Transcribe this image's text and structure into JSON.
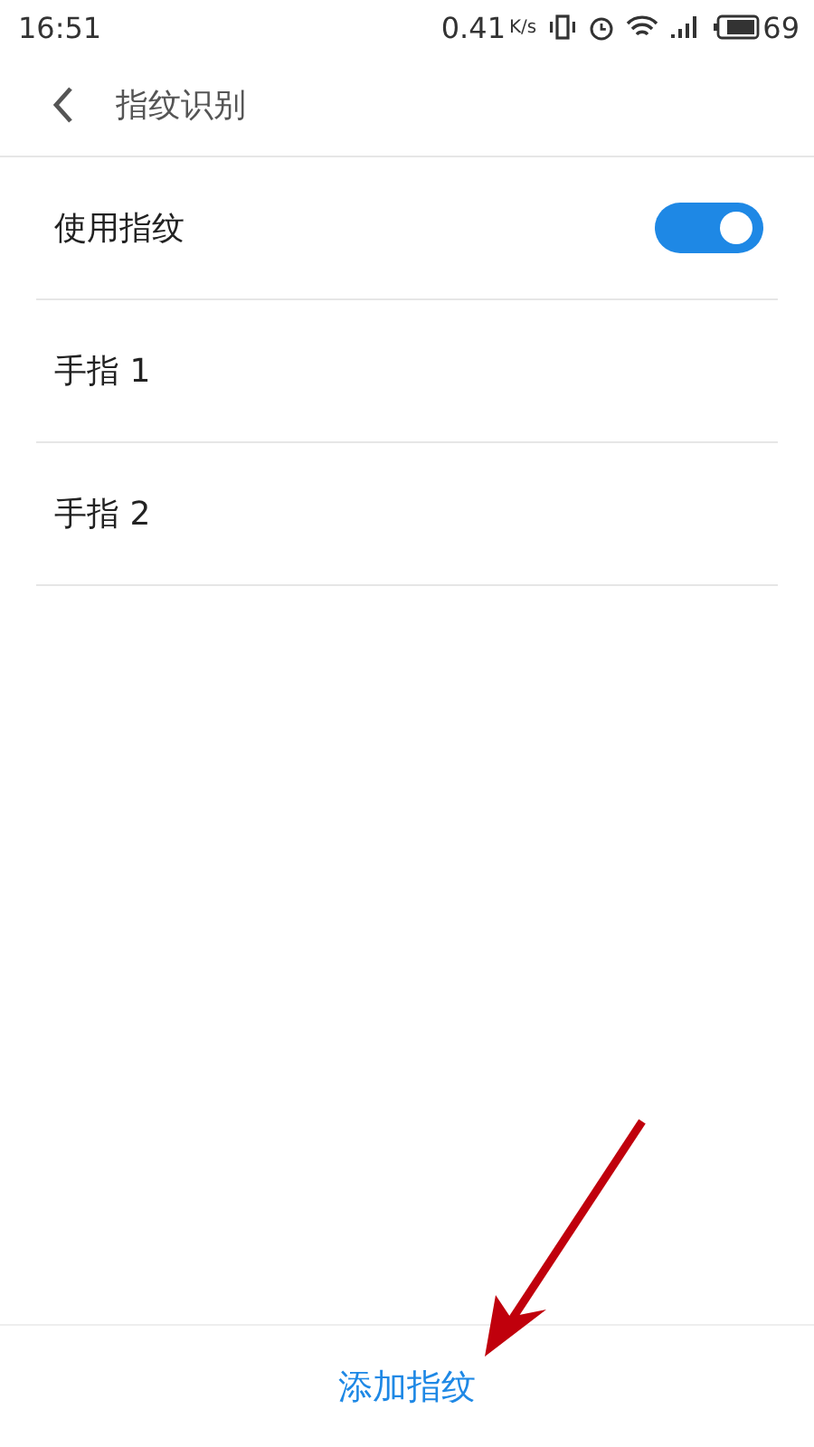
{
  "status_bar": {
    "time": "16:51",
    "net_speed": "0.41",
    "net_unit": "K/s",
    "battery": "69"
  },
  "header": {
    "back": true,
    "title": "指纹识别"
  },
  "items": [
    {
      "kind": "toggle",
      "label": "使用指纹",
      "on": true
    },
    {
      "kind": "item",
      "label": "手指 1"
    },
    {
      "kind": "item",
      "label": "手指 2"
    }
  ],
  "bottom_button": {
    "label": "添加指纹"
  },
  "annotation": {
    "kind": "arrow",
    "color": "#c0000c"
  }
}
